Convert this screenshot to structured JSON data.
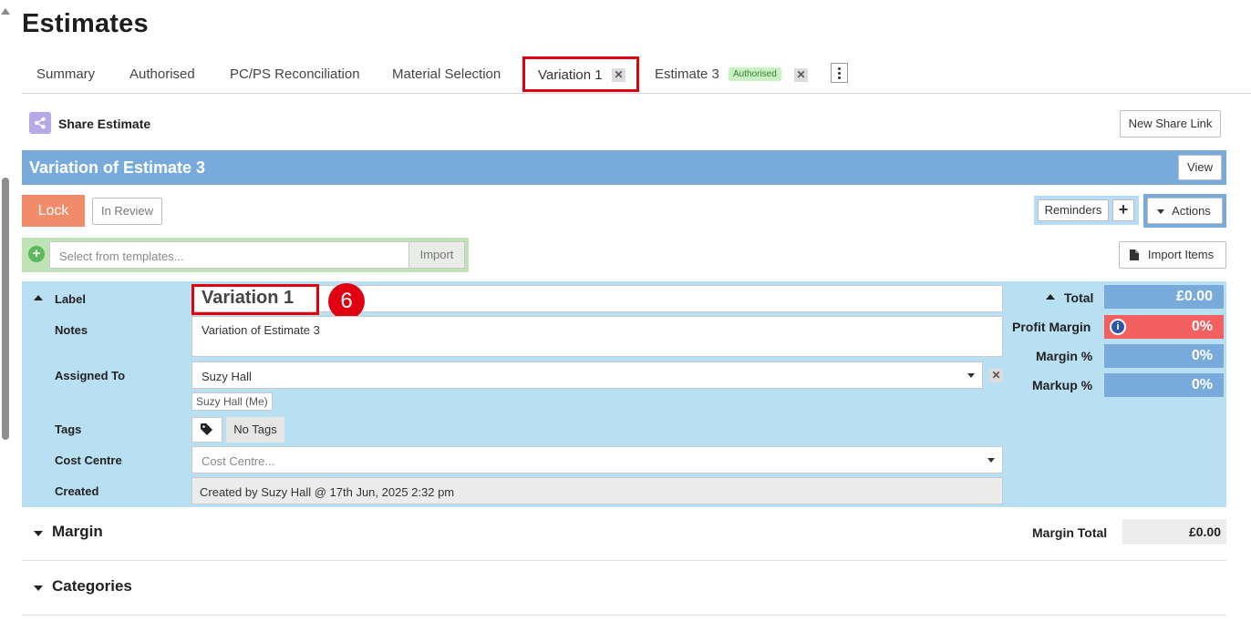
{
  "page": {
    "title": "Estimates"
  },
  "tabs": [
    {
      "label": "Summary"
    },
    {
      "label": "Authorised"
    },
    {
      "label": "PC/PS Reconciliation"
    },
    {
      "label": "Material Selection"
    },
    {
      "label": "Variation 1",
      "closable": true,
      "active": true
    },
    {
      "label": "Estimate 3",
      "badge": "Authorised",
      "closable": true
    }
  ],
  "tab_close_glyph": "✕",
  "share": {
    "label": "Share Estimate",
    "new_link_button": "New Share Link"
  },
  "variation": {
    "title": "Variation of Estimate 3",
    "view_button": "View"
  },
  "status": {
    "lock_button": "Lock",
    "in_review_button": "In Review"
  },
  "toolbar": {
    "reminders_button": "Reminders",
    "add_glyph": "+",
    "actions_button": "Actions",
    "import_items_button": "Import Items"
  },
  "templates": {
    "add_glyph": "+",
    "placeholder": "Select from templates...",
    "import_button": "Import"
  },
  "details": {
    "label_title": "Label",
    "label_value": "Variation 1",
    "annotation_step": "6",
    "notes_title": "Notes",
    "notes_value": "Variation of Estimate 3",
    "assigned_title": "Assigned To",
    "assigned_value": "Suzy Hall",
    "assigned_chip": "Suzy Hall (Me)",
    "clear_glyph": "✕",
    "tags_title": "Tags",
    "tags_value": "No Tags",
    "cost_centre_title": "Cost Centre",
    "cost_centre_placeholder": "Cost Centre...",
    "created_title": "Created",
    "created_value": "Created by Suzy Hall @ 17th Jun, 2025 2:32 pm"
  },
  "totals": {
    "total_label": "Total",
    "total_value": "£0.00",
    "profit_margin_label": "Profit Margin",
    "profit_margin_value": "0%",
    "info_glyph": "i",
    "margin_pct_label": "Margin %",
    "margin_pct_value": "0%",
    "markup_pct_label": "Markup %",
    "markup_pct_value": "0%"
  },
  "sections": {
    "margin_title": "Margin",
    "margin_total_label": "Margin Total",
    "margin_total_value": "£0.00",
    "categories_title": "Categories"
  },
  "colors": {
    "accent_blue": "#78aadb",
    "light_blue": "#b9dff3",
    "lock_orange": "#f08c6a",
    "profit_red": "#f2605f",
    "annotation_red": "#e0000f",
    "template_green": "#bfe3b7",
    "badge_green": "#c9f2c3"
  }
}
